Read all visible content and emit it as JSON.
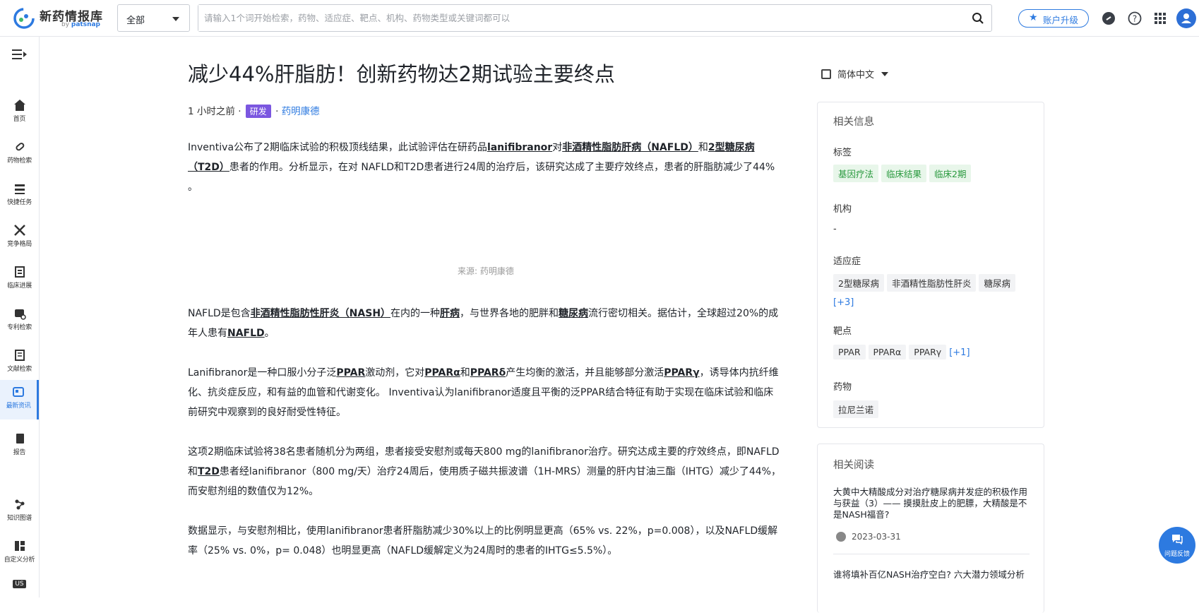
{
  "header": {
    "brand": "新药情报库",
    "brand_sub_prefix": "by ",
    "brand_sub_name": "patsnap",
    "scope": "全部",
    "search_placeholder": "请输入1个词开始检索，药物、适应症、靶点、机构、药物类型或关键词都可以",
    "upgrade": "账户升级"
  },
  "sidebar": {
    "items": [
      {
        "label": "首页"
      },
      {
        "label": "药物检索"
      },
      {
        "label": "快捷任务"
      },
      {
        "label": "竞争格局"
      },
      {
        "label": "临床进展"
      },
      {
        "label": "专利检索"
      },
      {
        "label": "文献检索"
      },
      {
        "label": "最新资讯"
      },
      {
        "label": "报告"
      },
      {
        "label": "知识图谱"
      },
      {
        "label": "自定义分析"
      },
      {
        "label": "US"
      }
    ]
  },
  "article": {
    "title": "减少44%肝脂肪！创新药物达2期试验主要终点",
    "time": "1 小时之前",
    "sep": "·",
    "tag": "研发",
    "source": "药明康德",
    "caption": "来源: 药明康德",
    "p1": {
      "a": "Inventiva公布了2期临床试验的积极顶线结果，此试验评估在研药品",
      "b": "lanifibranor",
      "c": "对",
      "d": "非酒精性脂肪肝病（NAFLD）",
      "e": "和",
      "f": "2型糖尿病（T2D）",
      "g": "患者的作用。分析显示，在对 NAFLD和T2D患者进行24周的治疗后，该研究达成了主要疗效终点，患者的肝脂肪减少了44% 。"
    },
    "p2": {
      "a": "NAFLD是包含",
      "b": "非酒精性脂肪性肝炎（NASH）",
      "c": "在内的一种",
      "d": "肝病",
      "e": "，与世界各地的肥胖和",
      "f": "糖尿病",
      "g": "流行密切相关。据估计，全球超过20%的成年人患有",
      "h": "NAFLD",
      "i": "。"
    },
    "p3": {
      "a": "Lanifibranor是一种口服小分子泛",
      "b": "PPAR",
      "c": "激动剂，它对",
      "d": "PPARα",
      "e": "和",
      "f": "PPARδ",
      "g": "产生均衡的激活，并且能够部分激活",
      "h": "PPARγ",
      "i": "，诱导体内抗纤维化、抗炎症反应，和有益的血管和代谢变化。 Inventiva认为lanifibranor适度且平衡的泛PPAR结合特征有助于实现在临床试验和临床前研究中观察到的良好耐受性特征。"
    },
    "p4": {
      "a": "这项2期临床试验将38名患者随机分为两组，患者接受安慰剂或每天800 mg的lanifibranor治疗。研究达成主要的疗效终点，即NAFLD和",
      "b": "T2D",
      "c": "患者经lanifibranor（800 mg/天）治疗24周后，使用质子磁共振波谱（1H-MRS）测量的肝内甘油三酯（IHTG）减少了44%，而安慰剂组的数值仅为12%。"
    },
    "p5": "数据显示，与安慰剂相比，使用lanifibranor患者肝脂肪减少30%以上的比例明显更高（65% vs. 22%，p=0.008），以及NAFLD缓解率（25% vs. 0%，p= 0.048）也明显更高（NAFLD缓解定义为24周时的患者的IHTG≤5.5%）。"
  },
  "panel": {
    "language": "简体中文",
    "info_title": "相关信息",
    "tags_label": "标签",
    "tags": [
      "基因疗法",
      "临床结果",
      "临床2期"
    ],
    "org_label": "机构",
    "org_value": "-",
    "indication_label": "适应症",
    "indications": [
      "2型糖尿病",
      "非酒精性脂肪性肝炎",
      "糖尿病"
    ],
    "indications_more": "[+3]",
    "target_label": "靶点",
    "targets": [
      "PPAR",
      "PPARα",
      "PPARγ"
    ],
    "targets_more": "[+1]",
    "drug_label": "药物",
    "drugs": [
      "拉尼兰诺"
    ],
    "reading_title": "相关阅读",
    "reading": [
      {
        "title": "大黄中大精酸成分对治疗糖尿病并发症的积极作用与获益（3）—— 摸摸肚皮上的肥膘，大精酸是不是NASH福音?",
        "date": "2023-03-31"
      },
      {
        "title": "谁将填补百亿NASH治疗空白? 六大潜力领域分析"
      }
    ]
  },
  "feedback": "问题反馈",
  "colors": {
    "accent": "#2d7ae0",
    "tag_purple": "#7b57e0",
    "chip_green": "#2a9a3f"
  }
}
